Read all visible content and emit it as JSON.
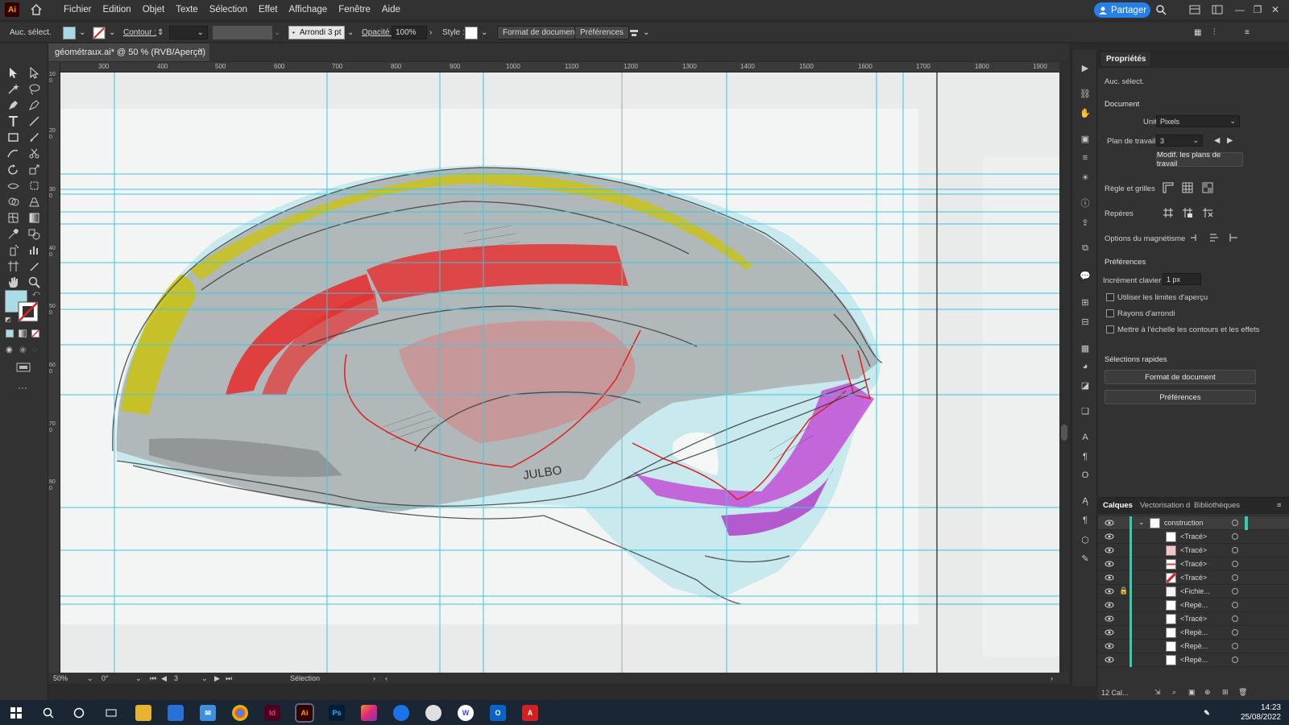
{
  "app": {
    "logo": "Ai",
    "menu": [
      "Fichier",
      "Edition",
      "Objet",
      "Texte",
      "Sélection",
      "Effet",
      "Affichage",
      "Fenêtre",
      "Aide"
    ],
    "share_label": "Partager"
  },
  "control_bar": {
    "selection_status": "Auc. sélect.",
    "contour_label": "Contour :",
    "stroke_profile": "Arrondi 3 pt",
    "opacity_label": "Opacité :",
    "opacity_value": "100%",
    "style_label": "Style :",
    "doc_format_button": "Format de document",
    "preferences_button": "Préférences"
  },
  "document": {
    "tab_title": "géométraux.ai* @ 50 % (RVB/Aperçu)",
    "close_symbol": "×"
  },
  "ruler": {
    "h_ticks": [
      "300",
      "400",
      "500",
      "600",
      "700",
      "800",
      "900",
      "1000",
      "1100",
      "1200",
      "1300",
      "1400",
      "1500",
      "1600",
      "1700",
      "1800",
      "1900"
    ],
    "v_ticks": [
      "100",
      "200",
      "300",
      "400",
      "500",
      "600",
      "700",
      "800"
    ]
  },
  "canvas": {
    "sketch_text": "JULBO"
  },
  "status_bar": {
    "zoom": "50%",
    "rotation": "0°",
    "artboard": "3",
    "tool": "Sélection"
  },
  "properties_panel": {
    "tab": "Propriétés",
    "selection": "Auc. sélect.",
    "document_heading": "Document",
    "units_label": "Unités :",
    "units_value": "Pixels",
    "artboard_label": "Plan de travail :",
    "artboard_value": "3",
    "edit_artboards_button": "Modif. les plans de travail",
    "rulers_grids_label": "Règle et grilles",
    "guides_label": "Repères",
    "snap_options_label": "Options du magnétisme",
    "preferences_heading": "Préférences",
    "keyboard_increment_label": "Incrément clavier :",
    "keyboard_increment_value": "1 px",
    "checkboxes": [
      "Utiliser les limites d'aperçu",
      "Rayons d'arrondi",
      "Mettre à l'échelle les contours et les effets"
    ],
    "quick_actions_heading": "Sélections rapides",
    "quick_doc_format_button": "Format de document",
    "quick_preferences_button": "Préférences"
  },
  "layers_panel": {
    "tabs": [
      "Calques",
      "Vectorisation d",
      "Bibliothèques"
    ],
    "layer_name": "construction",
    "rows": [
      "<Tracé>",
      "<Tracé>",
      "<Tracé>",
      "<Tracé>",
      "<Fichie...",
      "<Repè...",
      "<Tracé>",
      "<Repè...",
      "<Repè...",
      "<Repè..."
    ],
    "footer_count": "12 Cal..."
  },
  "taskbar": {
    "time": "14:23",
    "date": "25/08/2022",
    "apps": [
      "Id",
      "Ai",
      "Ps"
    ]
  }
}
